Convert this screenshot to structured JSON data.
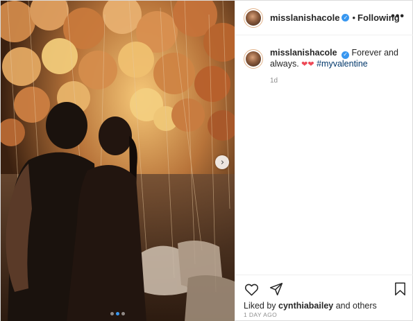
{
  "post": {
    "author": {
      "username": "misslanishacole",
      "verified": true,
      "follow_separator": "•",
      "follow_status": "Following",
      "avatar_icon": "profile-avatar"
    },
    "more_icon": "more-options-icon",
    "more_glyph": "•••",
    "caption": {
      "username": "misslanishacole",
      "text": "Forever and always. ",
      "emoji": "❤❤",
      "hashtag": "#myvalentine",
      "time": "1d"
    },
    "media": {
      "description_icon": "photo",
      "carousel": {
        "count": 3,
        "active_index": 1,
        "next_glyph": "›"
      }
    },
    "actions": {
      "like_icon": "heart-outline-icon",
      "share_icon": "paper-plane-icon",
      "save_icon": "bookmark-icon"
    },
    "likes": {
      "prefix": "Liked by ",
      "user": "cynthiabailey",
      "suffix": " and others"
    },
    "date": "1 DAY AGO"
  },
  "colors": {
    "link_blue": "#00376b",
    "verified_blue": "#3897f0",
    "heart_red": "#ed4956",
    "muted_gray": "#8e8e8e"
  }
}
